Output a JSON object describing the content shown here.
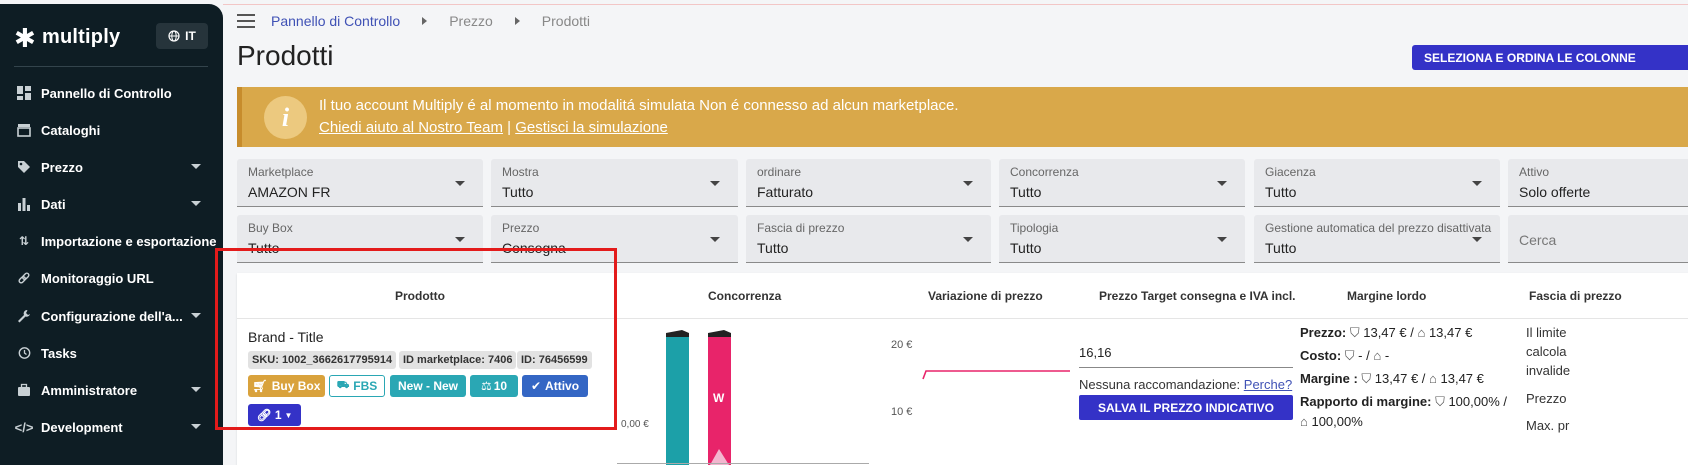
{
  "sidebar": {
    "logo": "multiply",
    "lang": "IT",
    "items": [
      {
        "label": "Pannello di Controllo",
        "icon": "dashboard-icon",
        "expand": false
      },
      {
        "label": "Cataloghi",
        "icon": "store-icon",
        "expand": false
      },
      {
        "label": "Prezzo",
        "icon": "tag-icon",
        "expand": true
      },
      {
        "label": "Dati",
        "icon": "bar-chart-icon",
        "expand": true
      },
      {
        "label": "Importazione e esportazione",
        "icon": "import-export-icon",
        "expand": false
      },
      {
        "label": "Monitoraggio URL",
        "icon": "link-icon",
        "expand": false
      },
      {
        "label": "Configurazione dell'a...",
        "icon": "wrench-icon",
        "expand": true
      },
      {
        "label": "Tasks",
        "icon": "history-icon",
        "expand": false
      },
      {
        "label": "Amministratore",
        "icon": "briefcase-icon",
        "expand": true
      },
      {
        "label": "Development",
        "icon": "code-icon",
        "expand": true
      }
    ]
  },
  "breadcrumb": {
    "items": [
      "Pannello di Controllo",
      "Prezzo",
      "Prodotti"
    ]
  },
  "page": {
    "title": "Prodotti",
    "select_button": "SELEZIONA E ORDINA LE COLONNE"
  },
  "banner": {
    "text": "Il tuo account Multiply é al momento in modalitá simulata Non é connesso ad alcun marketplace.",
    "link1": "Chiedi aiuto al Nostro Team",
    "separator": "|",
    "link2": "Gestisci la simulazione"
  },
  "filters": {
    "row1": [
      {
        "label": "Marketplace",
        "value": "AMAZON FR"
      },
      {
        "label": "Mostra",
        "value": "Tutto"
      },
      {
        "label": "ordinare",
        "value": "Fatturato"
      },
      {
        "label": "Concorrenza",
        "value": "Tutto"
      },
      {
        "label": "Giacenza",
        "value": "Tutto"
      },
      {
        "label": "Attivo",
        "value": "Solo offerte"
      }
    ],
    "row2": [
      {
        "label": "Buy Box",
        "value": "Tutto"
      },
      {
        "label": "Prezzo",
        "value": "Consegna"
      },
      {
        "label": "Fascia di prezzo",
        "value": "Tutto"
      },
      {
        "label": "Tipologia",
        "value": "Tutto"
      },
      {
        "label": "Gestione automatica del prezzo disattivata",
        "value": "Tutto"
      }
    ],
    "search_placeholder": "Cerca"
  },
  "table": {
    "headers": [
      "Prodotto",
      "Concorrenza",
      "Variazione di prezzo",
      "Prezzo Target consegna e IVA incl.",
      "Margine lordo",
      "Fascia di prezzo"
    ],
    "row": {
      "brand_title": "Brand - Title",
      "sku": "SKU: 1002_3662617795914",
      "marketplace_id": "ID marketplace: 7406",
      "id": "ID: 76456599",
      "badges": {
        "buybox": "Buy Box",
        "fbs": "FBS",
        "new": "New - New",
        "count": "10",
        "active": "Attivo",
        "links": "1"
      },
      "conc_y0": "0,00 €",
      "conc_w": "W",
      "var_y20": "20 €",
      "var_y10": "10 €",
      "target_price": "16,16",
      "no_reco": "Nessuna raccomandazione:",
      "why": "Perche?",
      "save_btn": "SALVA IL PREZZO INDICATIVO",
      "margin": {
        "prezzo_label": "Prezzo:",
        "prezzo_val1": "13,47 €",
        "prezzo_val2": "13,47 €",
        "costo_label": "Costo:",
        "costo_val1": "-",
        "costo_val2": "-",
        "margine_label": "Margine :",
        "margine_val1": "13,47 €",
        "margine_val2": "13,47 €",
        "rapporto_label": "Rapporto di margine:",
        "rapporto_val1": "100,00%",
        "rapporto_val2": "100,00%"
      },
      "fascia": {
        "line1": "Il limite",
        "line2": "calcola",
        "line3": "invalide",
        "line4": "Prezzo",
        "line5": "Max. pr"
      }
    }
  },
  "colors": {
    "primary": "#3432c7",
    "banner": "#d9a84a",
    "sidebar": "#0e1d24",
    "teal": "#1ca0a8",
    "pink": "#e8246a",
    "buybox": "#d9a23c",
    "fbs": "#2aa7b4",
    "highlight": "#e31b1b"
  }
}
